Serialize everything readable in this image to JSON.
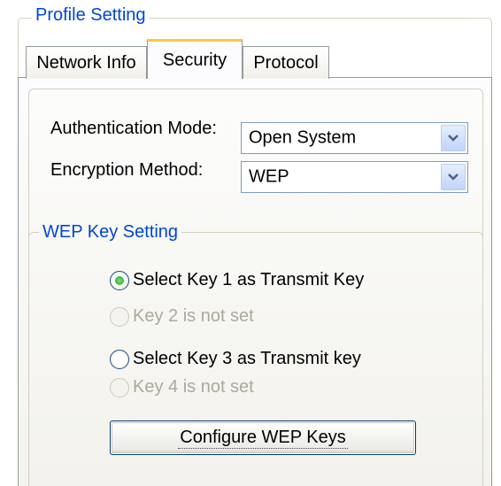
{
  "group": {
    "title": "Profile Setting"
  },
  "tabs": [
    {
      "label": "Network Info",
      "active": false
    },
    {
      "label": "Security",
      "active": true
    },
    {
      "label": "Protocol",
      "active": false
    }
  ],
  "security": {
    "auth_label": "Authentication Mode:",
    "auth_value": "Open System",
    "enc_label": "Encryption Method:",
    "enc_value": "WEP"
  },
  "wep": {
    "title": "WEP Key Setting",
    "options": [
      {
        "label": "Select Key 1 as Transmit Key",
        "checked": true,
        "enabled": true
      },
      {
        "label": "Key 2 is not set",
        "checked": false,
        "enabled": false
      },
      {
        "label": "Select Key 3 as Transmit key",
        "checked": false,
        "enabled": true
      },
      {
        "label": "Key 4 is not set",
        "checked": false,
        "enabled": false
      }
    ],
    "configure_label": "Configure WEP Keys"
  },
  "icons": {
    "dropdown": "chevron-down-icon"
  },
  "colors": {
    "accent_title": "#0046d5",
    "tab_highlight": "#ffc83c",
    "radio_checked": "#21a121"
  }
}
